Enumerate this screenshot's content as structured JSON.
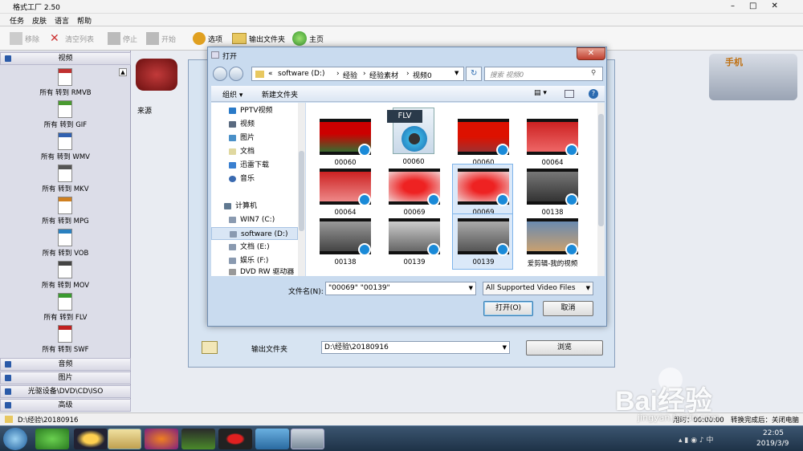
{
  "app": {
    "title": "格式工厂 2.50"
  },
  "menu": [
    "任务",
    "皮肤",
    "语言",
    "帮助"
  ],
  "toolbar": {
    "remove": "移除",
    "clear": "清空列表",
    "stop": "停止",
    "start": "开始",
    "options": "选项",
    "output_folder": "输出文件夹",
    "home": "主页"
  },
  "sidebar": {
    "video_header": "视频",
    "formats": [
      "所有 转到 RMVB",
      "所有 转到 GIF",
      "所有 转到 WMV",
      "所有 转到 MKV",
      "所有 转到 MPG",
      "所有 转到 VOB",
      "所有 转到 MOV",
      "所有 转到 FLV",
      "所有 转到 SWF"
    ],
    "format_tags": [
      "RMVB",
      "GIF",
      "WMV",
      "MKV",
      "MPG",
      "VOB",
      "MOV",
      "FLV",
      "SWF"
    ],
    "bottom_sections": [
      "音频",
      "图片",
      "光驱设备\\DVD\\CD\\ISO",
      "高级"
    ]
  },
  "main": {
    "phone_label": "手机",
    "source_header": "来源"
  },
  "bg_dialog": {
    "output_label": "输出文件夹",
    "output_path": "D:\\经验\\20180916",
    "browse": "浏览"
  },
  "dialog": {
    "title": "打开",
    "address": [
      "«",
      "software (D:)",
      "经验",
      "经验素材",
      "视频0"
    ],
    "search_placeholder": "搜索 视频0",
    "organize": "组织 ▾",
    "new_folder": "新建文件夹",
    "nav_items": [
      "PPTV视频",
      "视频",
      "图片",
      "文档",
      "迅雷下载",
      "音乐"
    ],
    "computer": "计算机",
    "drives": [
      "WIN7 (C:)",
      "software (D:)",
      "文档 (E:)",
      "娱乐 (F:)",
      "DVD RW 驱动器"
    ],
    "files": [
      "00060",
      "00060",
      "00060",
      "00064",
      "00064",
      "00069",
      "00069",
      "00138",
      "00138",
      "00139",
      "00139",
      "爱剪辑-我的视频"
    ],
    "flv_label": "FLV",
    "filename_label": "文件名(N):",
    "filename_value": "\"00069\" \"00139\"",
    "filetype": "All Supported Video Files",
    "open": "打开(O)",
    "cancel": "取消"
  },
  "status": {
    "path": "D:\\经验\\20180916",
    "right_a": "用时：00:00:00",
    "right_b": "转换完成后：关闭电脑"
  },
  "taskbar": {
    "time": "22:05",
    "date": "2019/3/9"
  },
  "watermark": {
    "brand": "Bai经验",
    "url": "jingyan.baidu.com"
  }
}
